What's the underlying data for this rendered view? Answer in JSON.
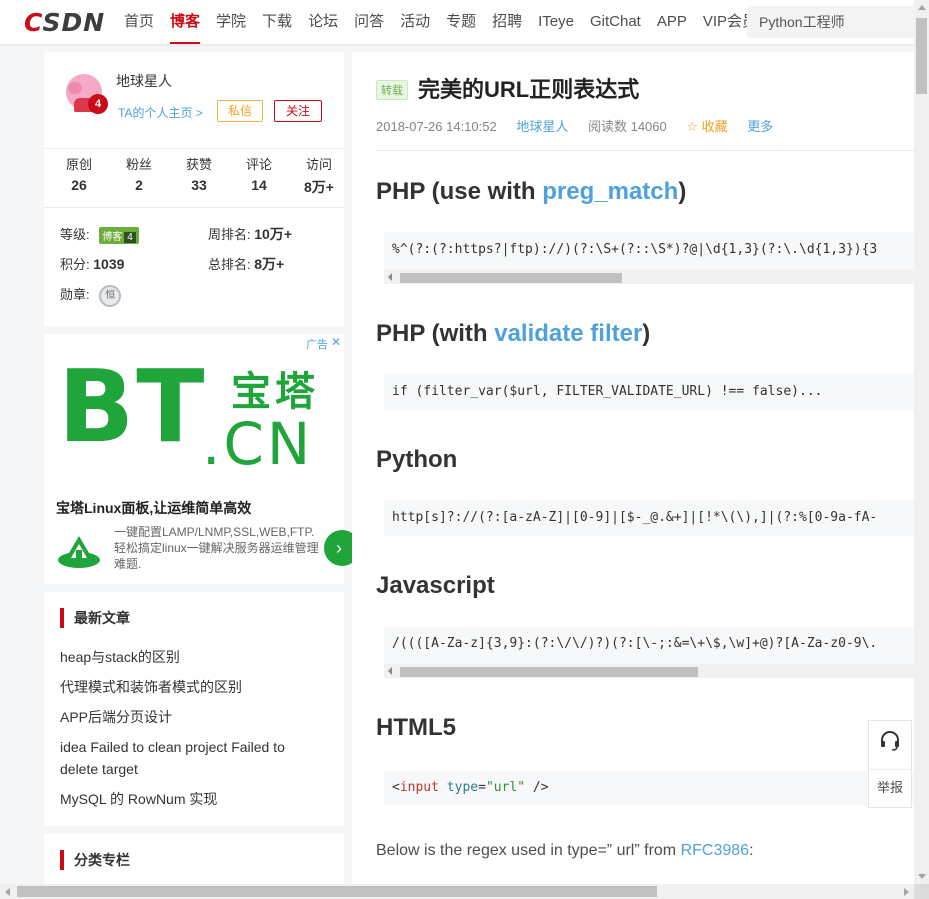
{
  "nav": {
    "logo_first": "C",
    "logo_rest": "SDN",
    "items": [
      "首页",
      "博客",
      "学院",
      "下载",
      "论坛",
      "问答",
      "活动",
      "专题",
      "招聘",
      "ITeye",
      "GitChat",
      "APP",
      "VIP会员"
    ],
    "active_index": 1,
    "search_value": "Python工程师",
    "brand_color": "#ca0c16"
  },
  "profile": {
    "username": "地球星人",
    "home_link": "TA的个人主页 >",
    "year_badge": "4",
    "message_button": "私信",
    "follow_button": "关注",
    "stats": [
      {
        "label": "原创",
        "value": "26"
      },
      {
        "label": "粉丝",
        "value": "2"
      },
      {
        "label": "获赞",
        "value": "33"
      },
      {
        "label": "评论",
        "value": "14"
      },
      {
        "label": "访问",
        "value": "8万+"
      }
    ],
    "level_label": "等级:",
    "level_badge": "博客",
    "level_num": "4",
    "week_rank_label": "周排名:",
    "week_rank": "10万+",
    "points_label": "积分:",
    "points": "1039",
    "total_rank_label": "总排名:",
    "total_rank": "8万+",
    "medal_label": "勋章:",
    "medal_icon": "恒"
  },
  "ad": {
    "label": "广告",
    "close": "✕",
    "big_text": "BT",
    "cn_text": "宝塔",
    "domain_text": ".CN",
    "title": "宝塔Linux面板,让运维简单高效",
    "desc": "一键配置LAMP/LNMP,SSL,WEB,FTP.轻松搞定linux一键解决服务器运维管理难题.",
    "go": "›",
    "accent": "#20a53a"
  },
  "recent": {
    "title": "最新文章",
    "items": [
      "heap与stack的区别",
      "代理模式和装饰者模式的区别",
      "APP后端分页设计",
      "idea Failed to clean project Failed to delete target",
      "MySQL 的 RowNum 实现"
    ]
  },
  "category": {
    "title": "分类专栏"
  },
  "article": {
    "repost_tag": "转载",
    "title": "完美的URL正则表达式",
    "date": "2018-07-26 14:10:52",
    "author": "地球星人",
    "reads": "阅读数 14060",
    "favorite": "☆ 收藏",
    "more": "更多",
    "sections": {
      "php_preg": {
        "pre": "PHP (use with ",
        "link": "preg_match",
        "post": ")",
        "code": "%^(?:(?:https?|ftp)://)(?:\\S+(?::\\S*)?@|\\d{1,3}(?:\\.\\d{1,3}){3"
      },
      "php_filter": {
        "pre": "PHP (with ",
        "link": "validate filter",
        "post": ")",
        "code": "if (filter_var($url, FILTER_VALIDATE_URL) !== false)..."
      },
      "python": {
        "title": "Python",
        "code": "http[s]?://(?:[a-zA-Z]|[0-9]|[$-_@.&+]|[!*\\(\\),]|(?:%[0-9a-fA-"
      },
      "javascript": {
        "title": "Javascript",
        "code": "/((([A-Za-z]{3,9}:(?:\\/\\/)?)(?:[\\-;:&=\\+\\$,\\w]+@)?[A-Za-z0-9\\."
      },
      "html5": {
        "title": "HTML5",
        "code_open": "<",
        "code_tag": "input",
        "code_attr": "type",
        "code_eq": "=",
        "code_val": "\"url\"",
        "code_close": " />"
      }
    },
    "paragraph_pre": "Below is the regex used in type=” url”  from ",
    "paragraph_link": "RFC3986",
    "paragraph_post": ":"
  },
  "float_tools": {
    "support_icon": "headset-icon",
    "report_label": "举报"
  }
}
